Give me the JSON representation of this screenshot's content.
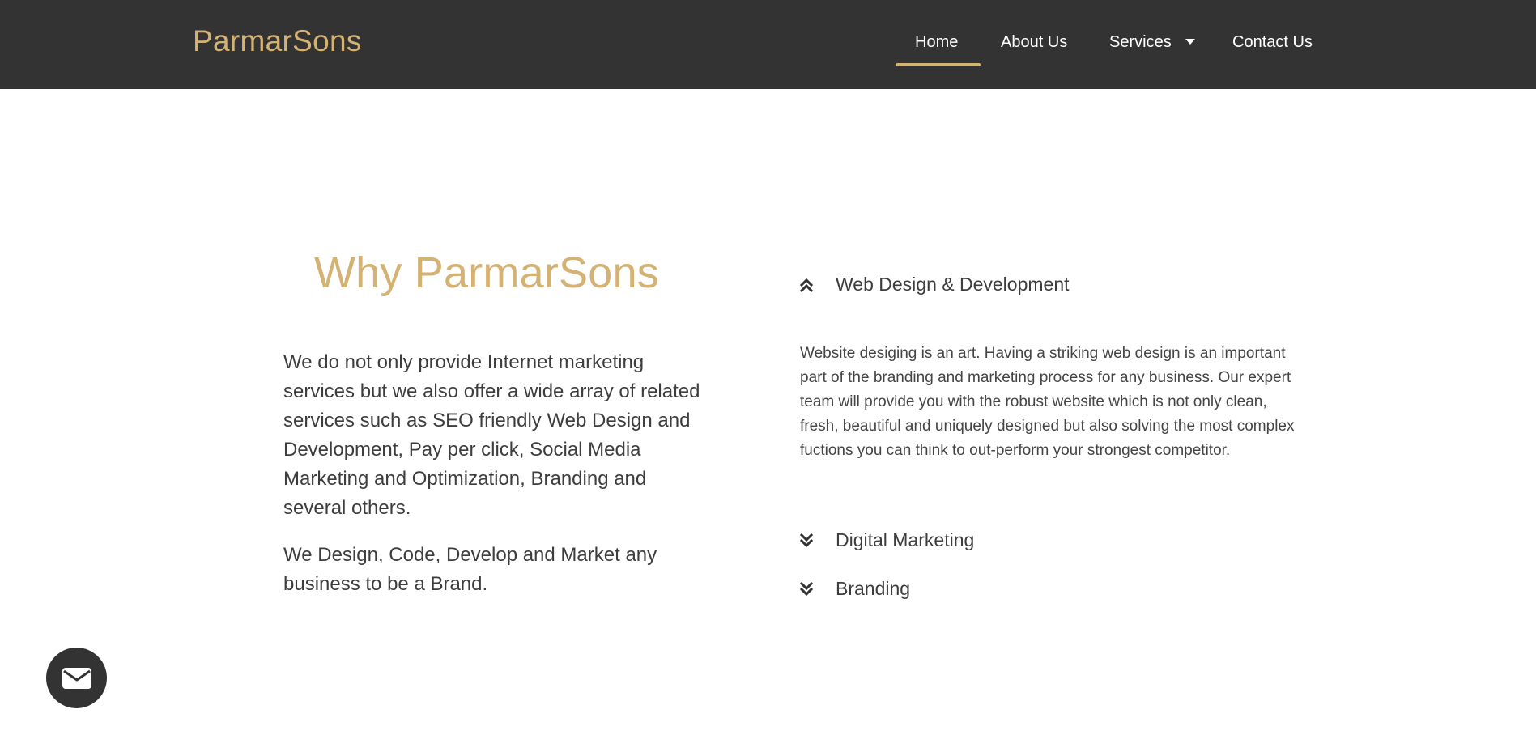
{
  "brand": {
    "name": "ParmarSons"
  },
  "nav": {
    "items": [
      {
        "label": "Home",
        "active": true
      },
      {
        "label": "About Us",
        "active": false
      },
      {
        "label": "Services",
        "active": false
      },
      {
        "label": "Contact Us",
        "active": false
      }
    ]
  },
  "why": {
    "title": "Why ParmarSons",
    "paragraphs": [
      "We do not only provide Internet marketing services but we also offer a wide array of related services such as SEO friendly Web Design and Development, Pay per click, Social Media Marketing and Optimization, Branding and several others.",
      "We Design, Code, Develop and Market any business to be a Brand."
    ]
  },
  "accordion": {
    "items": [
      {
        "title": "Web Design & Development",
        "expanded": true,
        "icon": "chevrons-up-icon",
        "content": "Website desiging is an art. Having a striking web design is an important part of the branding and marketing process for any business. Our expert team will provide you with the robust website which is not only clean, fresh, beautiful and uniquely designed but also solving the most complex fuctions you can think to out-perform your strongest competitor."
      },
      {
        "title": "Digital Marketing",
        "expanded": false,
        "icon": "chevrons-down-icon"
      },
      {
        "title": "Branding",
        "expanded": false,
        "icon": "chevrons-down-icon"
      }
    ]
  },
  "floating": {
    "icon": "mail-icon"
  },
  "colors": {
    "header_bg": "#333333",
    "accent": "#d4b273",
    "text": "#3d3d3d",
    "nav_text": "#ffffff"
  }
}
